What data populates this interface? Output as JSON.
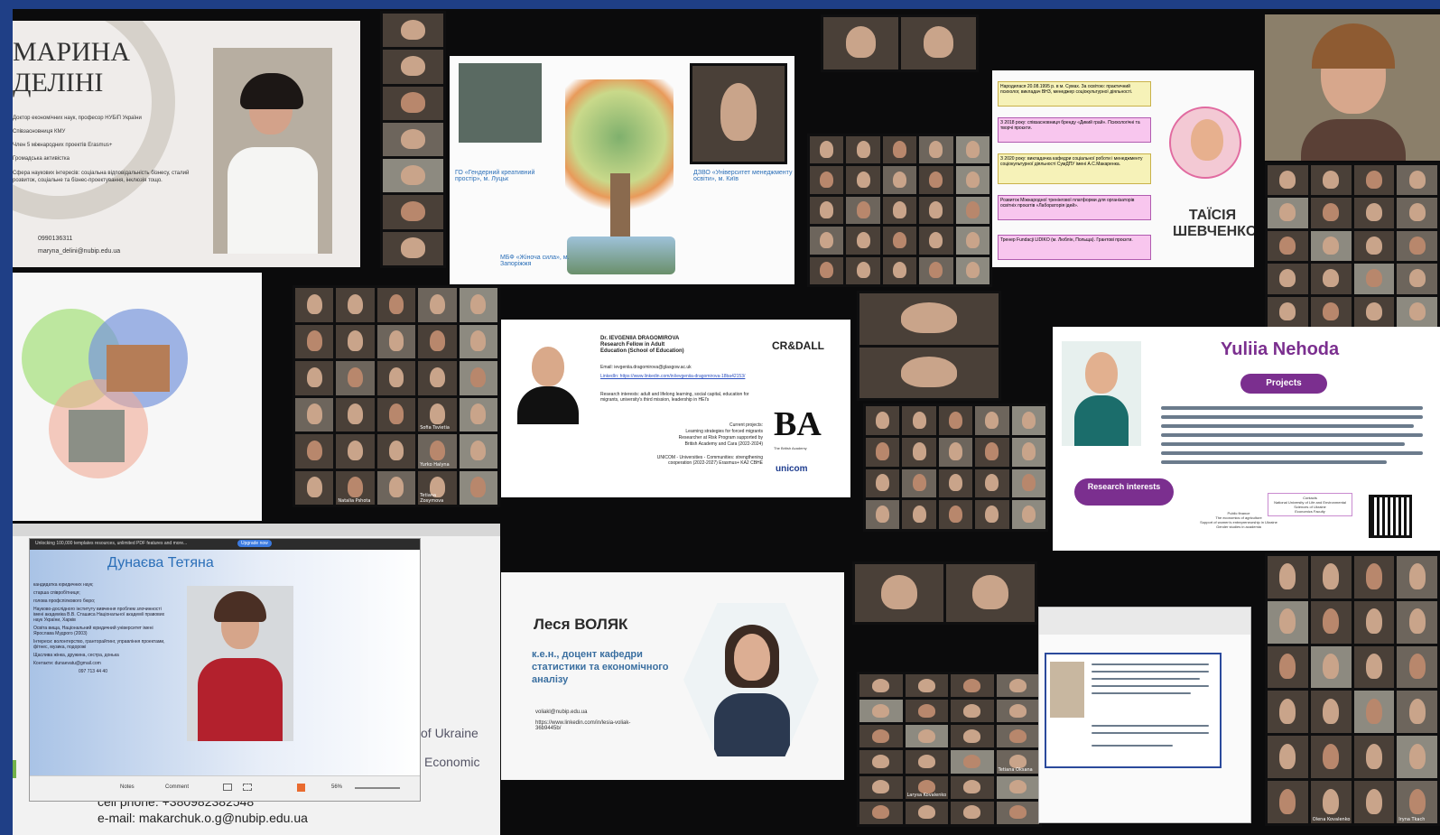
{
  "tiles": {
    "marina": {
      "name": "МАРИНА\nДЕЛІНІ",
      "lines": [
        "Доктор економічних наук, професор НУБіП України",
        "Співзасновниця КМУ",
        "Член 5 міжнародних проектів Erasmus+",
        "Громадська активістка",
        "Сфера наукових інтересів: соціальна відповідальність бізнесу, сталий розвиток, соціальне та бізнес-проектування, інклюзія тощо."
      ],
      "phone": "0990136311",
      "email": "maryna_delini@nubip.edu.ua"
    },
    "tree": {
      "label_left": "ГО «Гендерний креативний простір», м. Луцьк",
      "label_right": "ДЗВО «Університет менеджменту освіти», м. Київ",
      "label_bottom": "МБФ «Жіноча сила», м. Запоріжжя"
    },
    "taisia": {
      "name": "ТАЇСІЯ\nШЕВЧЕНКО",
      "boxes": [
        "Народилася 20.08.1995 р. в м. Сумах. За освітою: практичний психолог, викладач ВНЗ, менеджер соціокультурної діяльності.",
        "З 2018 року: співзасновниця бренду «Дикий грай». Психологічні та творчі проєкти.",
        "З 2020 року: викладачка кафедри соціальної роботи і менеджменту соціокультурної діяльності СумДПУ імені А.С.Макаренка.",
        "Розвиток Міжнародної тренінгової платформи для організаторів освітніх проєктів «Лабораторія ідей».",
        "Тренер Fundacji LIDIKO (м. Люблін, Польща). Грантові проєкти."
      ]
    },
    "dragomirova": {
      "title": "Dr. IEVGENIIA DRAGOMIROVA\nResearch Fellow in Adult\nEducation (School of Education)",
      "email": "Email: ievgeniia.dragomirova@glasgow.ac.uk",
      "linkedin": "LinkedIn: https://www.linkedin.com/in/ievgeniia-dragomirova-18ba42153/",
      "interests": "Research interests: adult and lifelong learning, social capital, education for migrants, university's third mission, leadership in HEI's",
      "current": "Current projects:\nLearning strategies for forced migrants\nResearcher at Risk Program supported by\nBritish Academy and Cara (2022-2024)",
      "unicom": "UNICOM - Universities - Communities: strengthening cooperation (2022-2027) Erasmus+ KA2 CBHE",
      "logo1": "CR&DALL",
      "logo2": "BA",
      "logo2_sub": "The British Academy",
      "logo3": "unicom"
    },
    "nehoda": {
      "name": "Yuliia Nehoda",
      "projects": "Projects",
      "research": "Research interests",
      "public_finance": "Public finance\nThe economics of agriculture\nSupport of women's entrepreneurship in Ukraine\nGender studies in academia",
      "contacts": "Contacts\nNational University of Life and Environmental Sciences of Ukraine\nEconomics Faculty"
    },
    "dunaeva": {
      "app_bar": "Unlocking 100,000 templates resources, unlimited PDF features and more...",
      "upgrade": "Upgrade now",
      "name": "Дунаєва Тетяна",
      "bullets": [
        "кандидатка юридичних наук;",
        "старша співробітниця;",
        "голова профспілкового бюро;",
        "Науково-дослідного інституту вивчення проблем злочинності імені академіка В.В. Сташиса Національної академії правових наук України, Харків",
        "Освіта вища, Національний юридичний університет імені Ярослава Мудрого (2003)",
        "Інтереси: волонтерство, гранторайтинг, управління проектами, фітнес, музика, подорожі",
        "Щаслива жінка, дружина, сестра, донька",
        "Контакти: dunaevatu@gmail.com"
      ],
      "phone": "097 713 44 40",
      "behind_1": "of Ukraine",
      "behind_2": "Economic",
      "cell": "cell phone: +380982382548",
      "email": "e-mail: makarchuk.o.g@nubip.edu.ua",
      "notes": "Notes",
      "comment": "Comment",
      "zoom": "56%"
    },
    "volyak": {
      "name": "Леся ВОЛЯК",
      "title": "к.е.н., доцент кафедри статистики та економічного аналізу",
      "email": "voliakl@nubip.edu.ua",
      "linkedin": "https://www.linkedin.com/in/lesia-voliak-36b9445b/"
    },
    "gallery_names": [
      "Tetiana Oksana",
      "Larysa Kovalenko",
      "Sofia Tsvietia",
      "Yurko Halyna",
      "Natalia Pshota",
      "Tetiana Zosymova",
      "Olena Kovalenko",
      "Iryna Tkach"
    ]
  },
  "colors": {
    "frame": "#1f3f86",
    "stage": "#0b0b0c",
    "accent_purple": "#7b2f8f",
    "blue_title": "#2b6fb8"
  }
}
